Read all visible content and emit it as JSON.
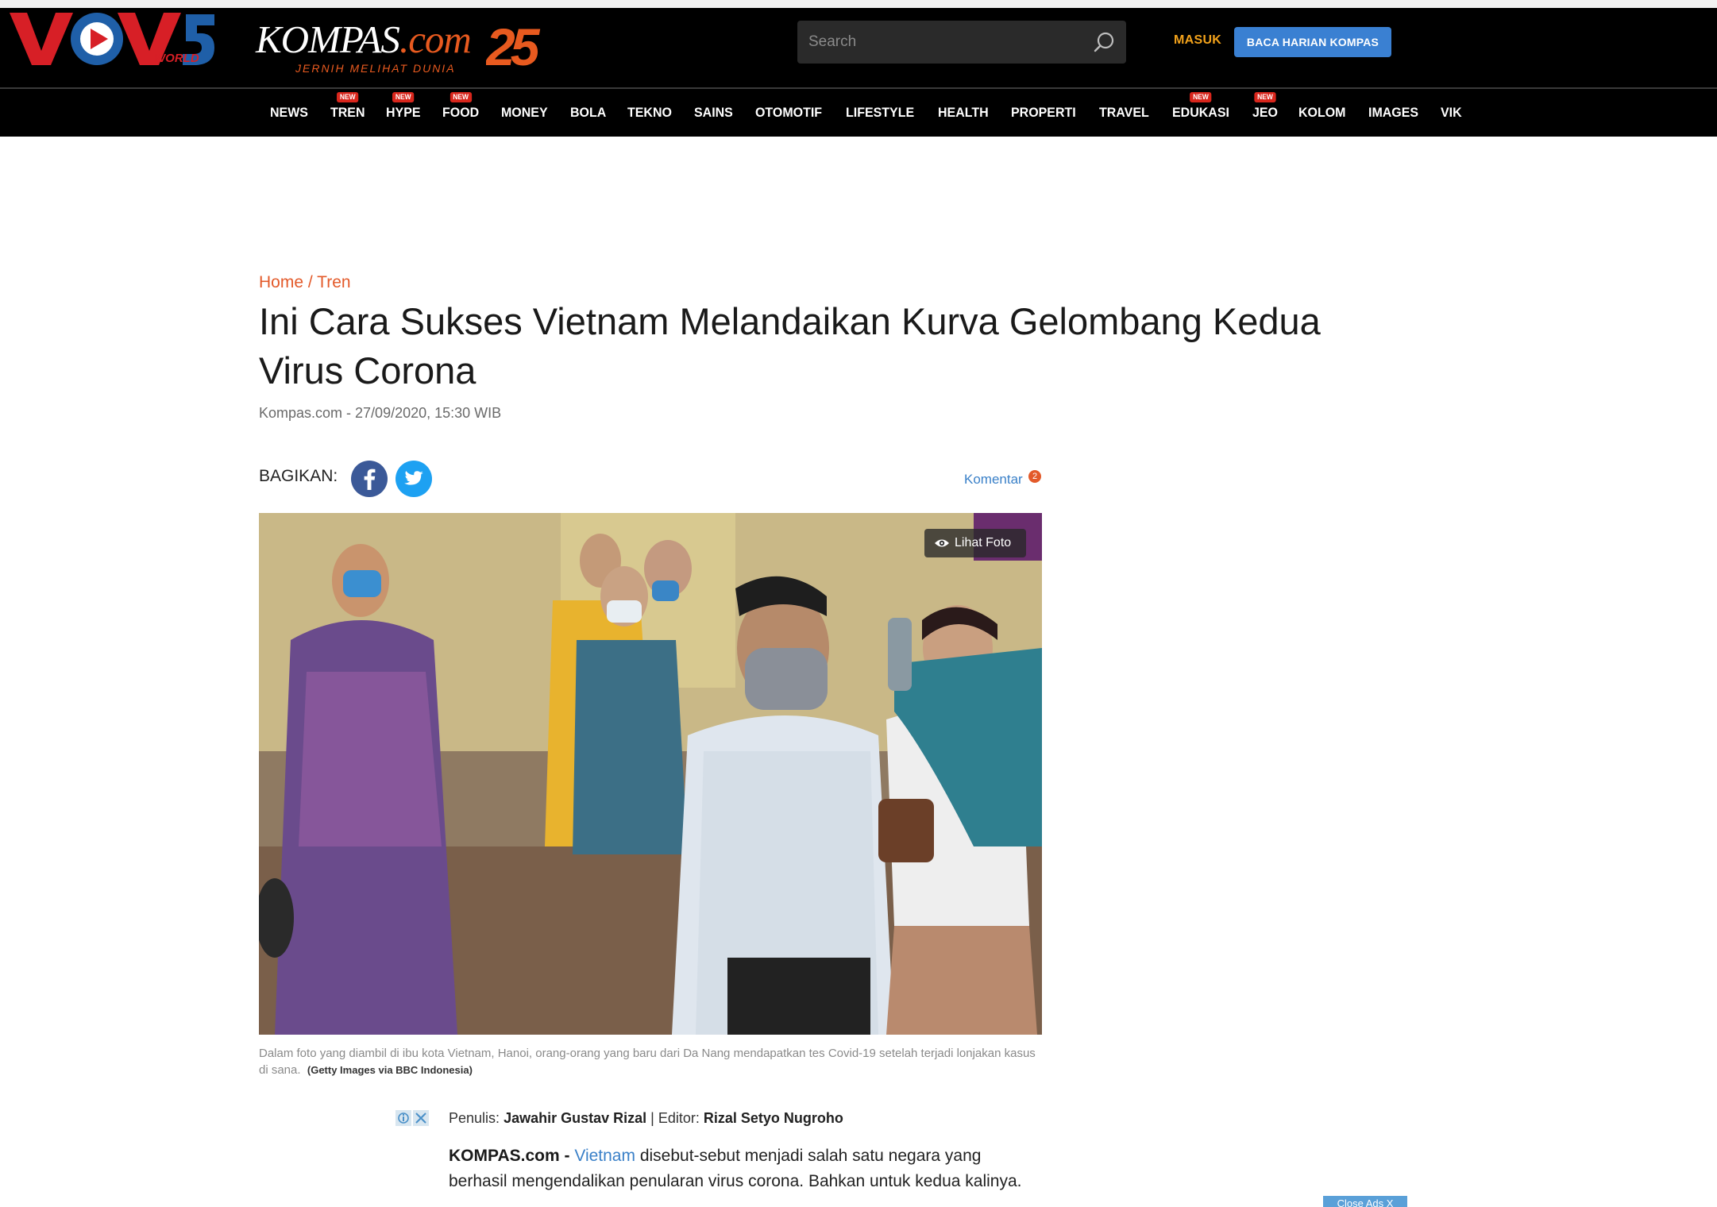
{
  "overlay_logo": {
    "text": "VOV5",
    "sub": "WORLD"
  },
  "brand": {
    "name": "KOMPAS",
    "tld": ".com",
    "tagline": "JERNIH MELIHAT DUNIA",
    "anniversary": "25",
    "colors": {
      "accent": "#e85a1f",
      "header_bg": "#000000",
      "button": "#3a80d2",
      "login": "#f2a21b"
    }
  },
  "search": {
    "placeholder": "Search"
  },
  "header": {
    "login_label": "MASUK",
    "cta_label": "BACA HARIAN KOMPAS"
  },
  "nav": {
    "items": [
      {
        "label": "NEWS",
        "badge": ""
      },
      {
        "label": "TREN",
        "badge": "NEW"
      },
      {
        "label": "HYPE",
        "badge": "NEW"
      },
      {
        "label": "FOOD",
        "badge": "NEW"
      },
      {
        "label": "MONEY",
        "badge": ""
      },
      {
        "label": "BOLA",
        "badge": ""
      },
      {
        "label": "TEKNO",
        "badge": ""
      },
      {
        "label": "SAINS",
        "badge": ""
      },
      {
        "label": "OTOMOTIF",
        "badge": ""
      },
      {
        "label": "LIFESTYLE",
        "badge": ""
      },
      {
        "label": "HEALTH",
        "badge": ""
      },
      {
        "label": "PROPERTI",
        "badge": ""
      },
      {
        "label": "TRAVEL",
        "badge": ""
      },
      {
        "label": "EDUKASI",
        "badge": "NEW"
      },
      {
        "label": "JEO",
        "badge": "NEW"
      },
      {
        "label": "KOLOM",
        "badge": ""
      },
      {
        "label": "IMAGES",
        "badge": ""
      },
      {
        "label": "VIK",
        "badge": ""
      }
    ]
  },
  "breadcrumb": {
    "home": "Home",
    "separator": " / ",
    "section": "Tren"
  },
  "article": {
    "title": "Ini Cara Sukses Vietnam Melandaikan Kurva Gelombang Kedua Virus Corona",
    "byline": "Kompas.com - 27/09/2020, 15:30 WIB",
    "share_label": "BAGIKAN:",
    "comment_label": "Komentar",
    "comment_count": "2",
    "photo_button": "Lihat Foto",
    "caption": "Dalam foto yang diambil di ibu kota Vietnam, Hanoi, orang-orang yang baru dari Da Nang mendapatkan tes Covid-19 setelah terjadi lonjakan kasus di sana.",
    "caption_credit": "(Getty Images via BBC Indonesia)",
    "writer_label": "Penulis:",
    "writer": "Jawahir Gustav Rizal",
    "editor_label": "| Editor:",
    "editor": "Rizal Setyo Nugroho",
    "lead": "KOMPAS.com -",
    "lead_link": "Vietnam",
    "body": "disebut-sebut menjadi salah satu negara yang berhasil mengendalikan penularan virus corona. Bahkan untuk kedua kalinya."
  },
  "ads": {
    "close_label": "Close Ads X"
  }
}
